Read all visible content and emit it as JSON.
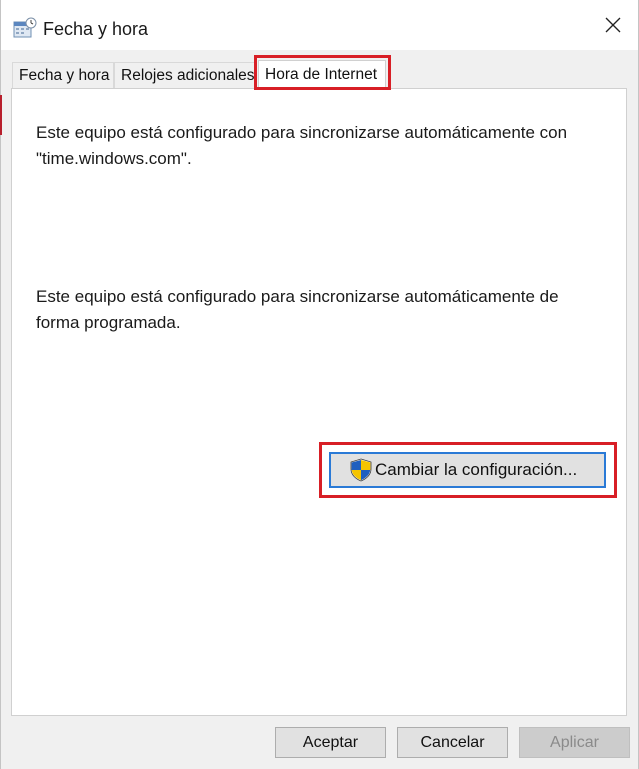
{
  "window": {
    "title": "Fecha y hora",
    "close_symbol": "✕"
  },
  "tabs": [
    {
      "label": "Fecha y hora",
      "active": false
    },
    {
      "label": "Relojes adicionales",
      "active": false
    },
    {
      "label": "Hora de Internet",
      "active": true
    }
  ],
  "panel": {
    "sync_server_text": "Este equipo está configurado para sincronizarse automáticamente con \"time.windows.com\".",
    "sync_schedule_text": "Este equipo está configurado para sincronizarse automáticamente de forma programada.",
    "change_settings_label": "Cambiar la configuración..."
  },
  "footer": {
    "accept_label": "Aceptar",
    "cancel_label": "Cancelar",
    "apply_label": "Aplicar",
    "apply_enabled": false
  },
  "colors": {
    "highlight": "#d81f26",
    "focus_border": "#2a7ad6",
    "shield_blue": "#1f5fbf",
    "shield_yellow": "#f5c400"
  },
  "icons": [
    "date-time-icon",
    "close-icon",
    "uac-shield-icon"
  ]
}
